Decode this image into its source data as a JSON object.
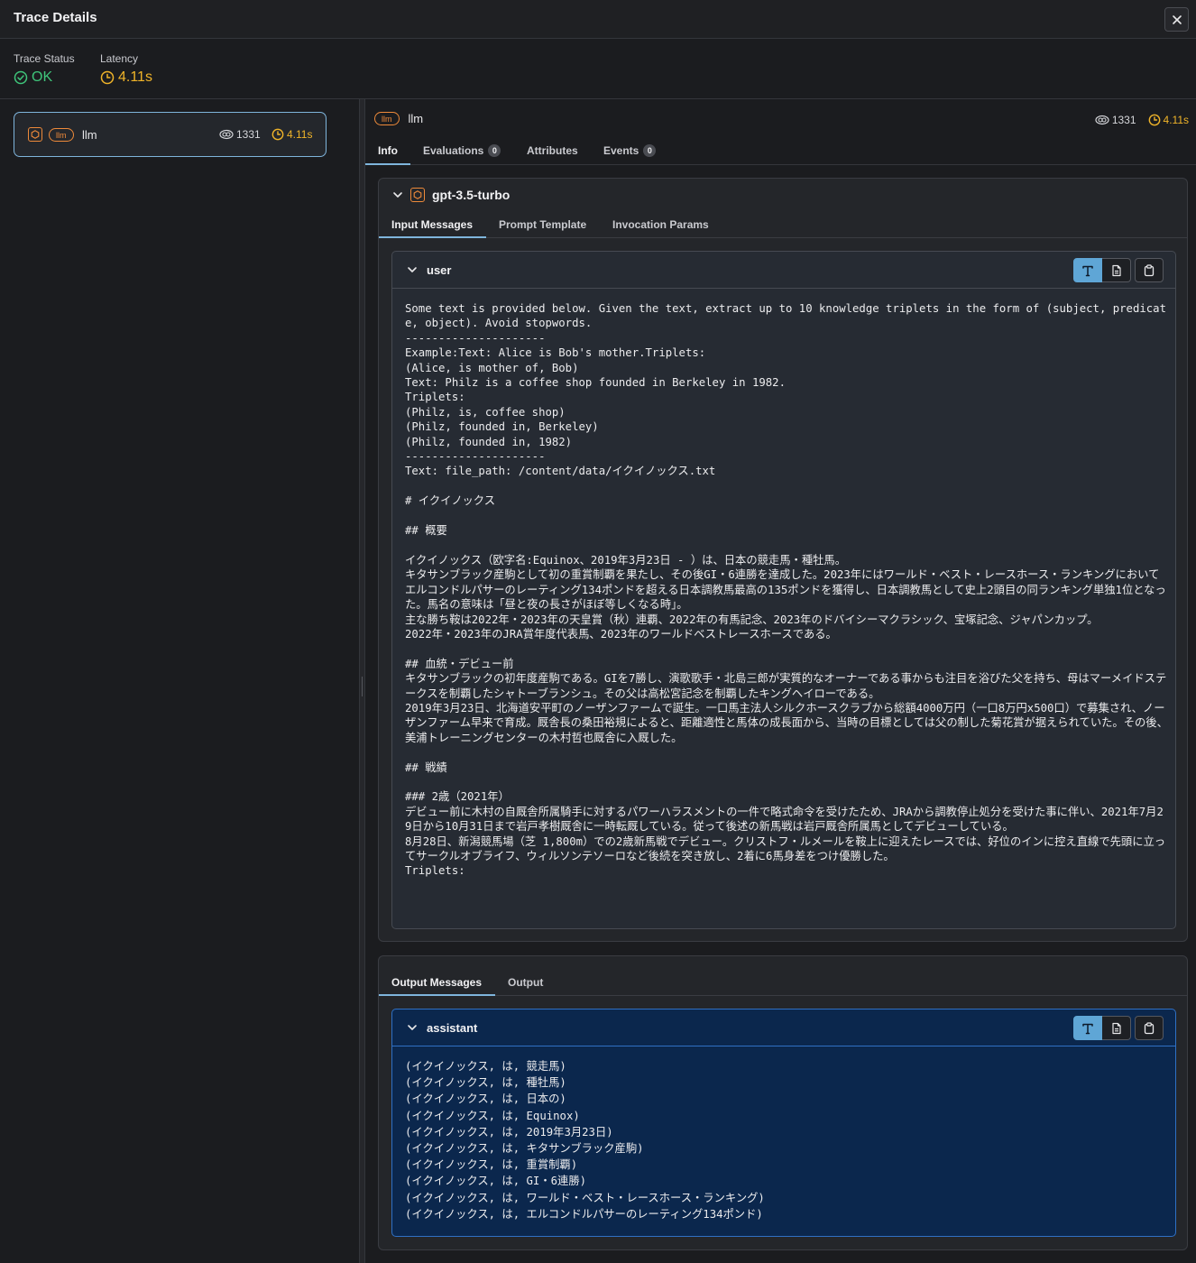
{
  "header": {
    "title": "Trace Details"
  },
  "summary": {
    "status_label": "Trace Status",
    "status_value": "OK",
    "latency_label": "Latency",
    "latency_value": "4.11s"
  },
  "tree": {
    "node": {
      "kind": "llm",
      "name": "llm",
      "tokens": "1331",
      "latency": "4.11s"
    }
  },
  "span": {
    "kind": "llm",
    "name": "llm",
    "tokens": "1331",
    "latency": "4.11s"
  },
  "tabs": [
    {
      "label": "Info",
      "count": null
    },
    {
      "label": "Evaluations",
      "count": "0"
    },
    {
      "label": "Attributes",
      "count": null
    },
    {
      "label": "Events",
      "count": "0"
    }
  ],
  "model": {
    "name": "gpt-3.5-turbo",
    "subtabs": [
      "Input Messages",
      "Prompt Template",
      "Invocation Params"
    ]
  },
  "input_message": {
    "role": "user",
    "content": "Some text is provided below. Given the text, extract up to 10 knowledge triplets in the form of (subject, predicate, object). Avoid stopwords.\n---------------------\nExample:Text: Alice is Bob's mother.Triplets:\n(Alice, is mother of, Bob)\nText: Philz is a coffee shop founded in Berkeley in 1982.\nTriplets:\n(Philz, is, coffee shop)\n(Philz, founded in, Berkeley)\n(Philz, founded in, 1982)\n---------------------\nText: file_path: /content/data/イクイノックス.txt\n\n# イクイノックス\n\n## 概要\n\nイクイノックス（欧字名:Equinox、2019年3月23日 - ）は、日本の競走馬・種牡馬。\nキタサンブラック産駒として初の重賞制覇を果たし、その後GI・6連勝を達成した。2023年にはワールド・ベスト・レースホース・ランキングにおいてエルコンドルパサーのレーティング134ポンドを超える日本調教馬最高の135ポンドを獲得し、日本調教馬として史上2頭目の同ランキング単独1位となった。馬名の意味は「昼と夜の長さがほぼ等しくなる時」。\n主な勝ち鞍は2022年・2023年の天皇賞（秋）連覇、2022年の有馬記念、2023年のドバイシーマクラシック、宝塚記念、ジャパンカップ。\n2022年・2023年のJRA賞年度代表馬、2023年のワールドベストレースホースである。\n\n## 血統・デビュー前\nキタサンブラックの初年度産駒である。GIを7勝し、演歌歌手・北島三郎が実質的なオーナーである事からも注目を浴びた父を持ち、母はマーメイドステークスを制覇したシャトーブランシュ。その父は高松宮記念を制覇したキングヘイローである。\n2019年3月23日、北海道安平町のノーザンファームで誕生。一口馬主法人シルクホースクラブから総額4000万円（一口8万円x500口）で募集され、ノーザンファーム早来で育成。厩舎長の桑田裕規によると、距離適性と馬体の成長面から、当時の目標としては父の制した菊花賞が据えられていた。その後、美浦トレーニングセンターの木村哲也厩舎に入厩した。\n\n## 戦績\n\n### 2歳（2021年）\nデビュー前に木村の自厩舎所属騎手に対するパワーハラスメントの一件で略式命令を受けたため、JRAから調教停止処分を受けた事に伴い、2021年7月29日から10月31日まで岩戸孝樹厩舎に一時転厩している。従って後述の新馬戦は岩戸厩舎所属馬としてデビューしている。\n8月28日、新潟競馬場（芝 1,800m）での2歳新馬戦でデビュー。クリストフ・ルメールを鞍上に迎えたレースでは、好位のインに控え直線で先頭に立ってサークルオブライフ、ウィルソンテソーロなど後続を突き放し、2着に6馬身差をつけ優勝した。\nTriplets:"
  },
  "output": {
    "subtabs": [
      "Output Messages",
      "Output"
    ]
  },
  "output_message": {
    "role": "assistant",
    "content": "(イクイノックス, は, 競走馬)\n(イクイノックス, は, 種牡馬)\n(イクイノックス, は, 日本の)\n(イクイノックス, は, Equinox)\n(イクイノックス, は, 2019年3月23日)\n(イクイノックス, は, キタサンブラック産駒)\n(イクイノックス, は, 重賞制覇)\n(イクイノックス, は, GI・6連勝)\n(イクイノックス, は, ワールド・ベスト・レースホース・ランキング)\n(イクイノックス, は, エルコンドルパサーのレーティング134ポンド)"
  },
  "colors": {
    "accent": "#7fb5dc",
    "ok": "#3fc57a",
    "latency": "#f0b429",
    "llm": "#ee8a3a",
    "assistant_bg": "#0b274d"
  }
}
